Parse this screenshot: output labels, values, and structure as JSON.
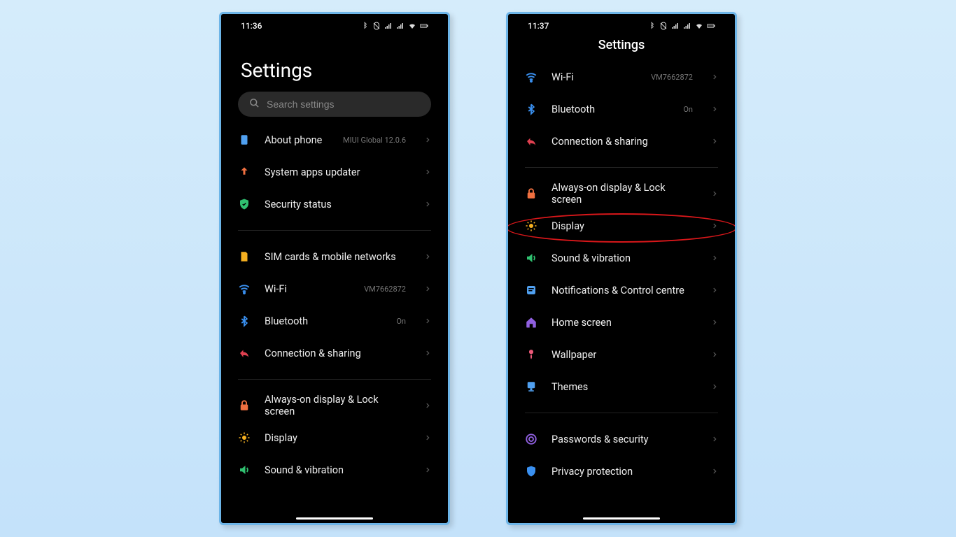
{
  "left": {
    "time": "11:36",
    "title": "Settings",
    "search_placeholder": "Search settings",
    "groups": [
      [
        {
          "icon": "about",
          "label": "About phone",
          "value": "MIUI Global 12.0.6"
        },
        {
          "icon": "updater",
          "label": "System apps updater",
          "value": ""
        },
        {
          "icon": "security",
          "label": "Security status",
          "value": ""
        }
      ],
      [
        {
          "icon": "sim",
          "label": "SIM cards & mobile networks",
          "value": ""
        },
        {
          "icon": "wifi",
          "label": "Wi-Fi",
          "value": "VM7662872"
        },
        {
          "icon": "bluetooth",
          "label": "Bluetooth",
          "value": "On"
        },
        {
          "icon": "share",
          "label": "Connection & sharing",
          "value": ""
        }
      ],
      [
        {
          "icon": "lock",
          "label": "Always-on display & Lock screen",
          "value": ""
        },
        {
          "icon": "display",
          "label": "Display",
          "value": ""
        },
        {
          "icon": "sound",
          "label": "Sound & vibration",
          "value": ""
        }
      ]
    ]
  },
  "right": {
    "time": "11:37",
    "title": "Settings",
    "highlight_index": 4,
    "groups": [
      [
        {
          "icon": "wifi",
          "label": "Wi-Fi",
          "value": "VM7662872"
        },
        {
          "icon": "bluetooth",
          "label": "Bluetooth",
          "value": "On"
        },
        {
          "icon": "share",
          "label": "Connection & sharing",
          "value": ""
        }
      ],
      [
        {
          "icon": "lock",
          "label": "Always-on display & Lock screen",
          "value": ""
        },
        {
          "icon": "display",
          "label": "Display",
          "value": ""
        },
        {
          "icon": "sound",
          "label": "Sound & vibration",
          "value": ""
        },
        {
          "icon": "notif",
          "label": "Notifications & Control centre",
          "value": ""
        },
        {
          "icon": "home",
          "label": "Home screen",
          "value": ""
        },
        {
          "icon": "wallpaper",
          "label": "Wallpaper",
          "value": ""
        },
        {
          "icon": "themes",
          "label": "Themes",
          "value": ""
        }
      ],
      [
        {
          "icon": "passwords",
          "label": "Passwords & security",
          "value": ""
        },
        {
          "icon": "privacy",
          "label": "Privacy protection",
          "value": ""
        }
      ]
    ]
  }
}
